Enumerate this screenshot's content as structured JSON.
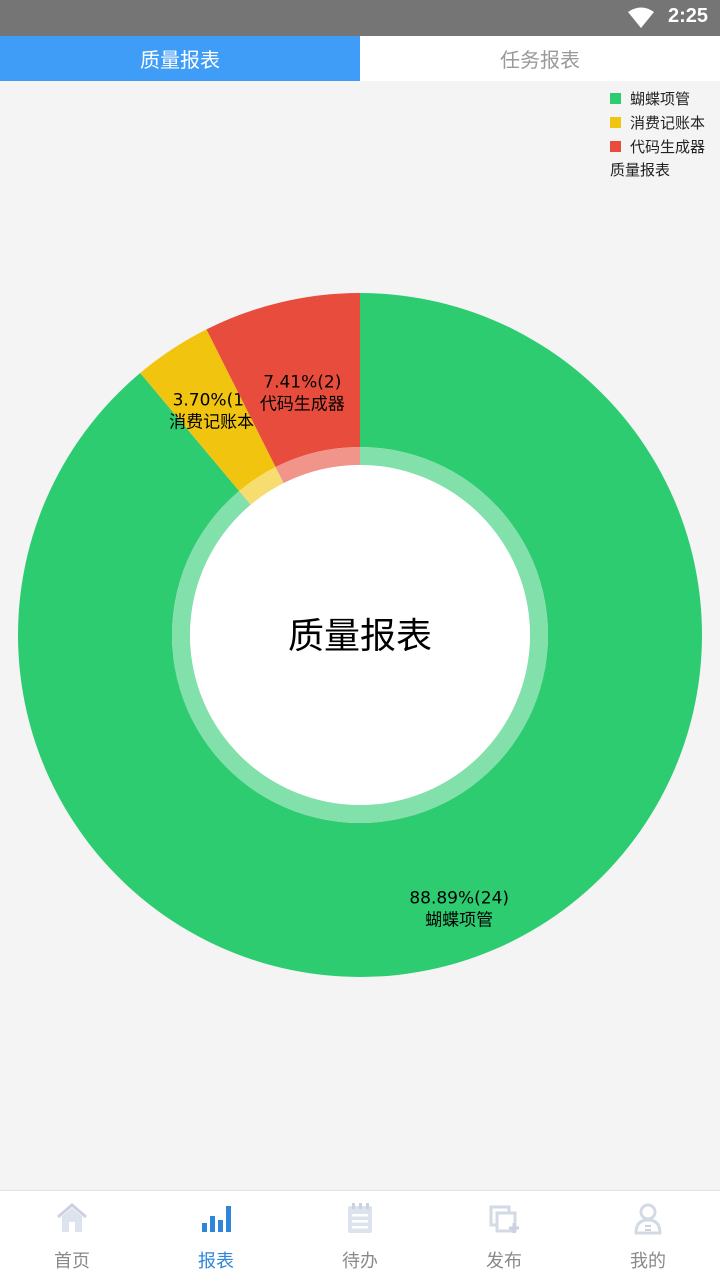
{
  "status_bar": {
    "time": "2:25",
    "icons": [
      "wifi-icon"
    ]
  },
  "tabs": [
    {
      "label": "质量报表",
      "active": true
    },
    {
      "label": "任务报表",
      "active": false
    }
  ],
  "chart_data": {
    "type": "pie",
    "variant": "donut",
    "center_text": "质量报表",
    "legend_placement": "top-right",
    "legend_note": "质量报表",
    "slices": [
      {
        "name": "蝴蝶项管",
        "percent": 88.89,
        "count": 24,
        "label_value": "88.89%(24)",
        "color": "#2ecc71"
      },
      {
        "name": "消费记账本",
        "percent": 3.7,
        "count": 1,
        "label_value": "3.70%(1)",
        "color": "#f1c40f"
      },
      {
        "name": "代码生成器",
        "percent": 7.41,
        "count": 2,
        "label_value": "7.41%(2)",
        "color": "#e74c3c"
      }
    ]
  },
  "bottom_nav": [
    {
      "label": "首页",
      "icon": "home-icon",
      "active": false
    },
    {
      "label": "报表",
      "icon": "bar-chart-icon",
      "active": true
    },
    {
      "label": "待办",
      "icon": "notepad-icon",
      "active": false
    },
    {
      "label": "发布",
      "icon": "publish-icon",
      "active": false
    },
    {
      "label": "我的",
      "icon": "user-icon",
      "active": false
    }
  ],
  "colors": {
    "primary": "#3f9df8",
    "nav_active": "#2f86d8",
    "nav_inactive": "#8a8a8a"
  }
}
